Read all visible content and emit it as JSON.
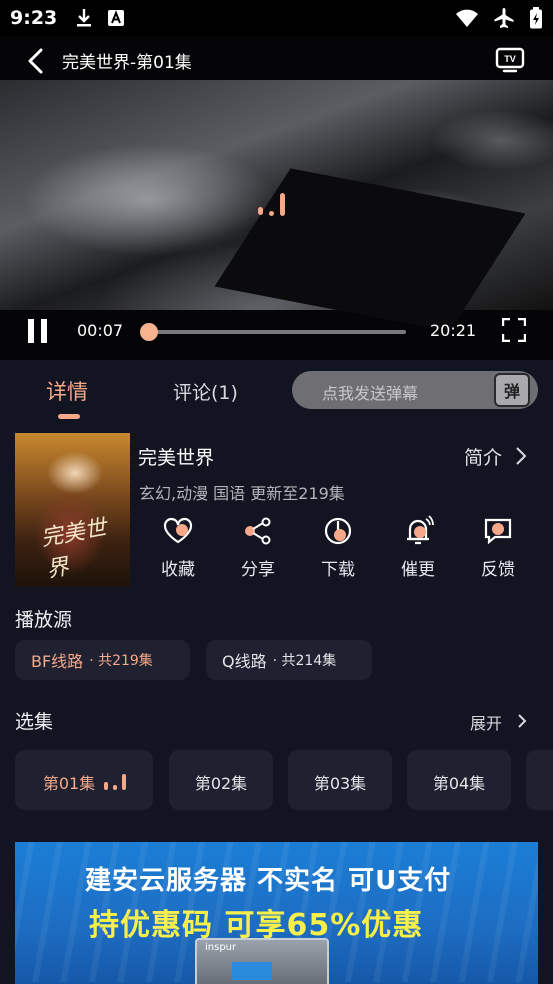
{
  "status_bar": {
    "time": "9:23",
    "icons_left": [
      "download-icon",
      "a-letter-icon"
    ],
    "icons_right": [
      "wifi-icon",
      "airplane-icon",
      "battery-icon"
    ]
  },
  "player": {
    "title": "完美世界-第01集",
    "current_time": "00:07",
    "total_time": "20:21",
    "progress_fraction": 0.006
  },
  "tabs": {
    "details": "详情",
    "comments": "评论(1)",
    "danmaku_placeholder": "点我发送弹幕",
    "danmaku_badge": "弹"
  },
  "show": {
    "title": "完美世界",
    "intro_link": "简介",
    "meta": "玄幻,动漫 国语 更新至219集",
    "poster_text": "完美世界",
    "actions": [
      {
        "label": "收藏",
        "icon": "heart-icon"
      },
      {
        "label": "分享",
        "icon": "share-icon"
      },
      {
        "label": "下载",
        "icon": "download-circle-icon"
      },
      {
        "label": "催更",
        "icon": "bell-icon"
      },
      {
        "label": "反馈",
        "icon": "feedback-icon"
      }
    ]
  },
  "sources": {
    "title": "播放源",
    "items": [
      {
        "name": "BF线路",
        "count": "· 共219集"
      },
      {
        "name": "Q线路",
        "count": "· 共214集"
      }
    ]
  },
  "episodes": {
    "title": "选集",
    "expand": "展开",
    "items": [
      "第01集",
      "第02集",
      "第03集",
      "第04集"
    ]
  },
  "ad": {
    "line1": "建安云服务器 不实名 可U支付",
    "line2": "持优惠码   可享65%优惠",
    "server_brand": "inspur"
  },
  "colors": {
    "accent": "#f6a889",
    "background": "#121421",
    "chip": "#1f2130"
  }
}
